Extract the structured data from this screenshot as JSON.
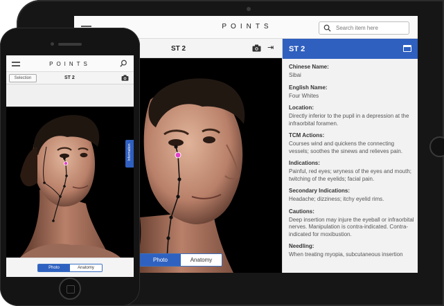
{
  "app": {
    "logo": "POINTS"
  },
  "tablet": {
    "search": {
      "placeholder": "Search item here"
    },
    "point_title": "ST 2",
    "segment": {
      "photo": "Photo",
      "anatomy": "Anatomy",
      "selected": "Photo"
    },
    "info": {
      "title": "ST 2",
      "sections": [
        {
          "label": "Chinese Name:",
          "text": "Sibai"
        },
        {
          "label": "English Name:",
          "text": "Four Whites"
        },
        {
          "label": "Location:",
          "text": "Directly inferior to the pupil in a depression at the infraorbital foramen."
        },
        {
          "label": "TCM Actions:",
          "text": "Courses wind and quickens the connecting vessels; soothes the sinews and relieves pain."
        },
        {
          "label": "Indications:",
          "text": "Painful, red eyes; wryness of the eyes and mouth; twitching of the eyelids; facial pain."
        },
        {
          "label": "Secondary Indications:",
          "text": "Headache; dizziness; itchy eyelid rims."
        },
        {
          "label": "Cautions:",
          "text": "Deep insertion may injure the eyeball or infraorbital nerves. Manipulation is contra-indicated. Contra-indicated for moxibustion."
        },
        {
          "label": "Needling:",
          "text": "When treating myopia, subcutaneous insertion"
        }
      ]
    }
  },
  "phone": {
    "selection_label": "Selection",
    "point_title": "ST 2",
    "information_tab": "Information",
    "segment": {
      "photo": "Photo",
      "anatomy": "Anatomy",
      "selected": "Photo"
    }
  },
  "icons": [
    "menu-icon",
    "search-icon",
    "camera-icon",
    "collapse-panel-icon",
    "info-card-icon"
  ],
  "colors": {
    "accent": "#2f5fbf",
    "device_frame": "#161616",
    "point_highlight": "#e040c8"
  }
}
